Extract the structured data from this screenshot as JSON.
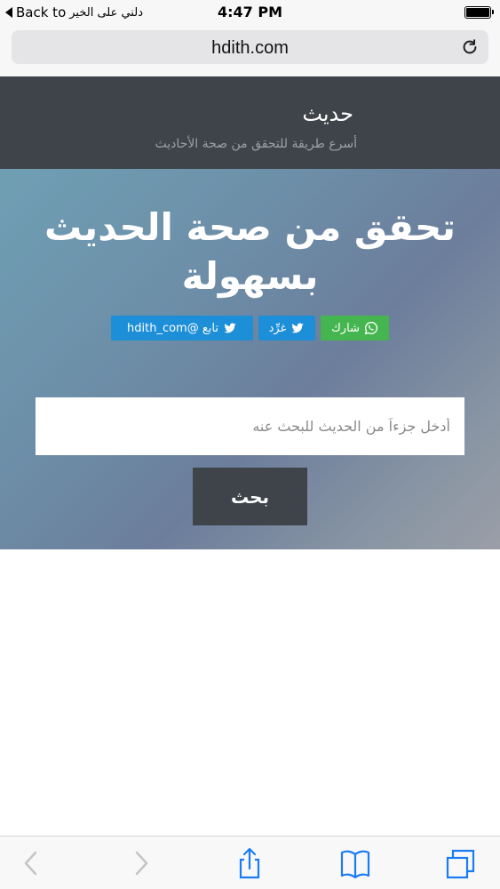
{
  "status_bar": {
    "back_label": "Back to",
    "back_app": "دلني على الخير",
    "time": "4:47 PM"
  },
  "url_bar": {
    "url": "hdith.com"
  },
  "site_header": {
    "title": "حديث",
    "tagline": "أسرع طريقة للتحقق من صحة الأحاديث"
  },
  "hero": {
    "heading_line1": "تحقق من صحة الحديث",
    "heading_line2": "بسهولة",
    "share_buttons": {
      "whatsapp": "شارك",
      "tweet": "غرِّد",
      "follow": "تابع @hdith_com"
    },
    "search": {
      "placeholder": "أدخل جزءاً من الحديث للبحث عنه",
      "value": "",
      "button_label": "بحث"
    }
  },
  "colors": {
    "header_bg": "#3e4449",
    "whatsapp_green": "#45b64f",
    "twitter_blue": "#1d8ed8",
    "ios_blue": "#1a7cf5"
  },
  "toolbar_icons": [
    "back-arrow-icon",
    "forward-arrow-icon",
    "share-icon",
    "bookmarks-icon",
    "tabs-icon"
  ]
}
